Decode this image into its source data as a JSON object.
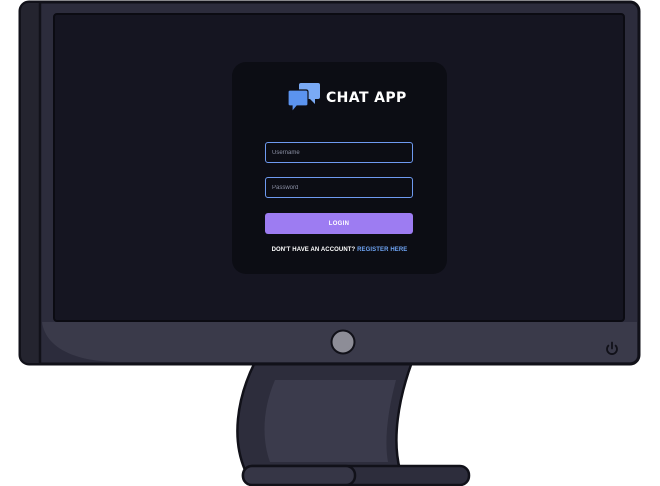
{
  "app": {
    "name": "CHAT APP",
    "brand_icon": "chat-bubbles-icon",
    "colors": {
      "card_background": "#0c0d14",
      "accent_blue": "#6ea4f4",
      "accent_purple": "#9d7cf2",
      "monitor_frame": "#2c2c3c",
      "screen_background": "#151521"
    }
  },
  "login_form": {
    "username_placeholder": "Username",
    "password_placeholder": "Password",
    "login_label": "LOGIN",
    "register_prompt": "DON'T HAVE AN ACCOUNT?",
    "register_link": "REGISTER HERE"
  },
  "monitor": {
    "power_icon": "power-icon",
    "camera_icon": "webcam-icon"
  }
}
